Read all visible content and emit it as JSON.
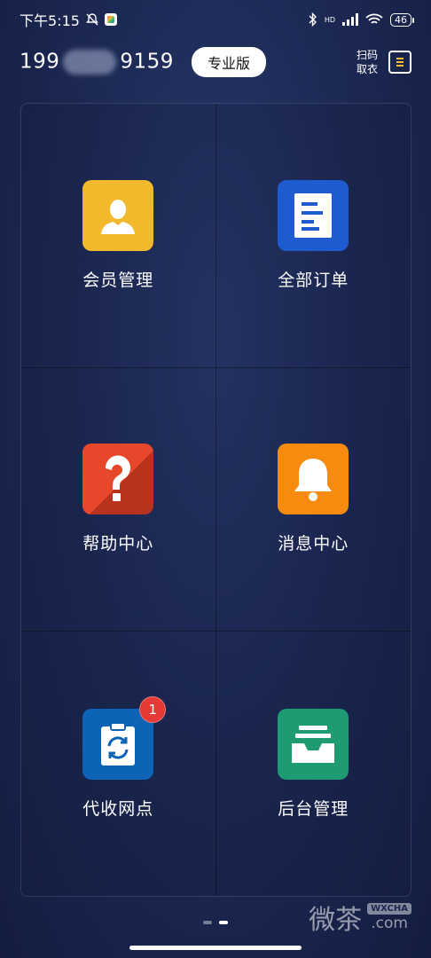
{
  "status_bar": {
    "time": "下午5:15",
    "battery": "46",
    "network": "HD"
  },
  "header": {
    "phone_prefix": "199",
    "phone_suffix": "9159",
    "edition_label": "专业版",
    "scan_line1": "扫码",
    "scan_line2": "取衣"
  },
  "tiles": [
    {
      "label": "会员管理",
      "icon": "member-icon",
      "color": "#f5b82e"
    },
    {
      "label": "全部订单",
      "icon": "orders-icon",
      "color": "#1e5bd1"
    },
    {
      "label": "帮助中心",
      "icon": "help-icon",
      "color": "#e0442a"
    },
    {
      "label": "消息中心",
      "icon": "bell-icon",
      "color": "#f78b10"
    },
    {
      "label": "代收网点",
      "icon": "clipboard-sync-icon",
      "color": "#0d63b5",
      "badge": "1"
    },
    {
      "label": "后台管理",
      "icon": "inbox-tray-icon",
      "color": "#1e9b72"
    }
  ],
  "watermark": {
    "main": "微茶",
    "badge": "WXCHA",
    "sub": ".com"
  }
}
